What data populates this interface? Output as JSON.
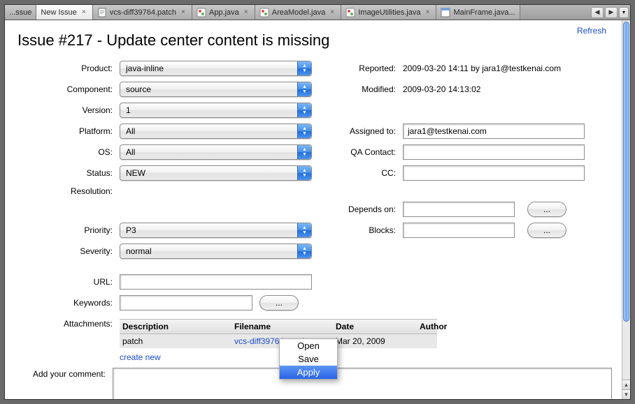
{
  "tabs": {
    "t0": "...ssue",
    "t1": "New Issue",
    "t2": "vcs-diff39764.patch",
    "t3": "App.java",
    "t4": "AreaModel.java",
    "t5": "ImageUtilities.java",
    "t6": "MainFrame.java..."
  },
  "refresh": "Refresh",
  "title": "Issue #217 - Update center content is missing",
  "labels": {
    "product": "Product:",
    "component": "Component:",
    "version": "Version:",
    "platform": "Platform:",
    "os": "OS:",
    "status": "Status:",
    "resolution": "Resolution:",
    "priority": "Priority:",
    "severity": "Severity:",
    "url": "URL:",
    "keywords": "Keywords:",
    "attachments": "Attachments:",
    "reported": "Reported:",
    "modified": "Modified:",
    "assigned": "Assigned to:",
    "qacontact": "QA Contact:",
    "cc": "CC:",
    "depends": "Depends on:",
    "blocks": "Blocks:",
    "addcomment": "Add your comment:"
  },
  "values": {
    "product": "java-inline",
    "component": "source",
    "version": "1",
    "platform": "All",
    "os": "All",
    "status": "NEW",
    "priority": "P3",
    "severity": "normal",
    "url": "",
    "keywords": "",
    "reported": "2009-03-20 14:11 by jara1@testkenai.com",
    "modified": "2009-03-20 14:13:02",
    "assigned": "jara1@testkenai.com",
    "qacontact": "",
    "cc": "",
    "depends": "",
    "blocks": ""
  },
  "buttons": {
    "ellipsis": "...",
    "createnew": "create new"
  },
  "att": {
    "head_desc": "Description",
    "head_file": "Filename",
    "head_date": "Date",
    "head_auth": "Author",
    "row_desc": "patch",
    "row_file": "vcs-diff39764.patch",
    "row_date": "Mar 20, 2009",
    "row_auth": ""
  },
  "ctx": {
    "open": "Open",
    "save": "Save",
    "apply": "Apply"
  }
}
